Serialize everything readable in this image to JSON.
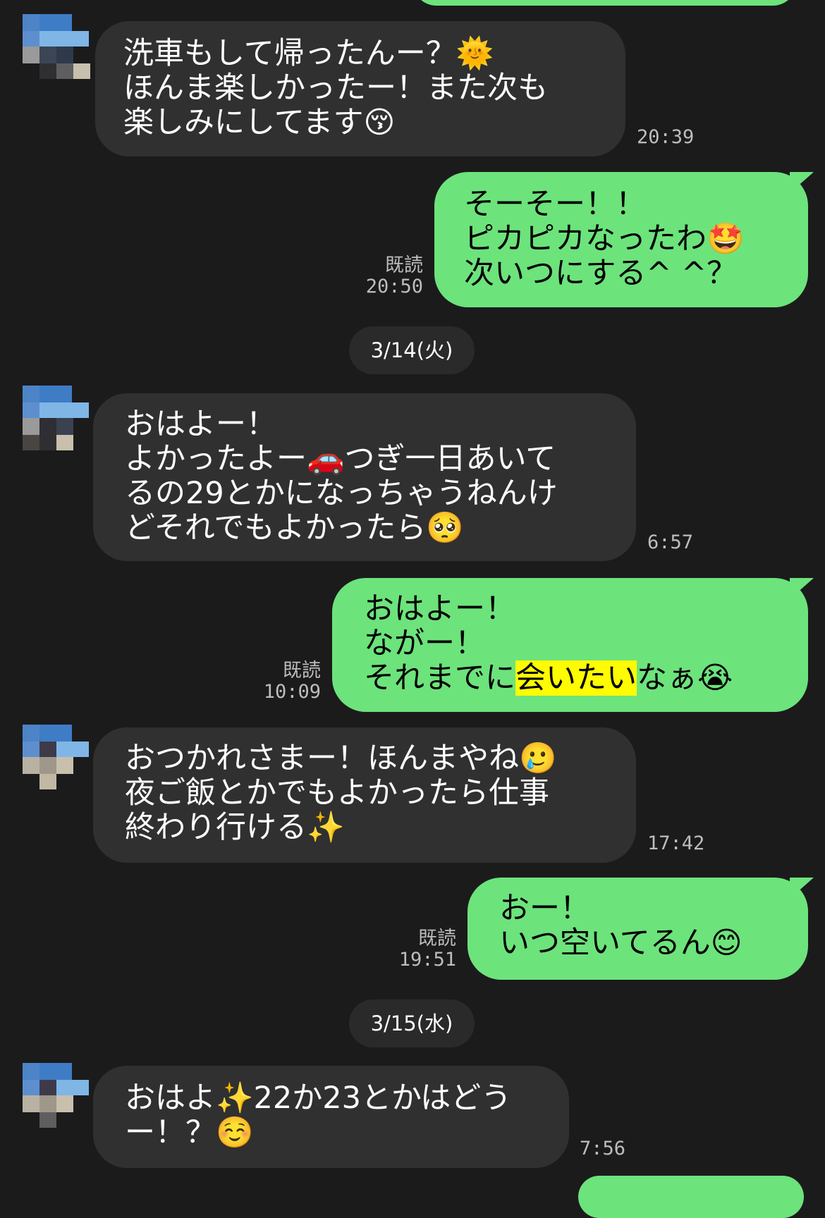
{
  "messages": [
    {
      "lines": [
        "洗車もして帰ったんー？🌞",
        "ほんま楽しかったー！また次も",
        "楽しみにしてます😚"
      ],
      "time": "20:39"
    },
    {
      "lines": [
        "そーそー！！",
        "ピカピカなったわ🤩",
        "次いつにする^ ^？"
      ],
      "read": "既読",
      "time": "20:50"
    },
    {
      "date": "3/14(火)"
    },
    {
      "lines": [
        "おはよー！",
        "よかったよー🚗つぎ一日あいて",
        "るの29とかになっちゃうねんけ",
        "どそれでもよかったら🥺"
      ],
      "time": "6:57"
    },
    {
      "lines": [
        "おはよー！",
        "ながー！"
      ],
      "line3_before": "それまでに",
      "line3_hl": "会いたい",
      "line3_after": "なぁ😭",
      "read": "既読",
      "time": "10:09"
    },
    {
      "lines": [
        "おつかれさまー！ほんまやね🥲",
        "夜ご飯とかでもよかったら仕事",
        "終わり行ける✨"
      ],
      "time": "17:42"
    },
    {
      "lines": [
        "おー！",
        "いつ空いてるん😊"
      ],
      "read": "既読",
      "time": "19:51"
    },
    {
      "date": "3/15(水)"
    },
    {
      "lines": [
        "おはよ✨22か23とかはどう",
        "ー！？☺️"
      ],
      "time": "7:56"
    }
  ],
  "colors": {
    "background": "#1b1b1c",
    "incoming": "#303031",
    "outgoing": "#6de37c",
    "highlight": "#fffb00"
  }
}
